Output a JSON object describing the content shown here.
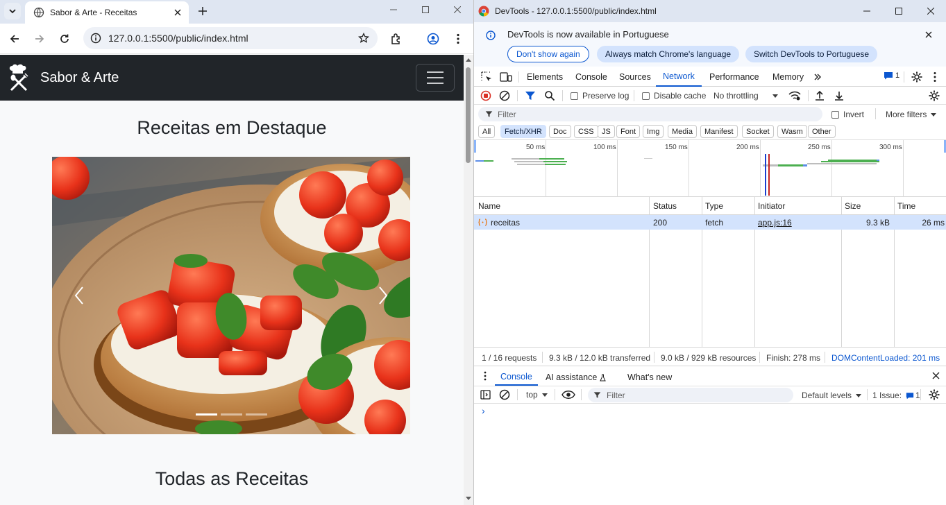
{
  "browser": {
    "tab_title": "Sabor & Arte - Receitas",
    "url": "127.0.0.1:5500/public/index.html"
  },
  "page": {
    "brand": "Sabor & Arte",
    "featured_heading": "Receitas em Destaque",
    "all_heading": "Todas as Receitas",
    "carousel": {
      "slides": 3,
      "active_slide": 1
    }
  },
  "devtools": {
    "title": "DevTools - 127.0.0.1:5500/public/index.html",
    "infobar": {
      "message": "DevTools is now available in Portuguese",
      "dont_show": "Don't show again",
      "always_match": "Always match Chrome's language",
      "switch": "Switch DevTools to Portuguese"
    },
    "panel_tabs": [
      "Elements",
      "Console",
      "Sources",
      "Network",
      "Performance",
      "Memory"
    ],
    "active_panel": "Network",
    "issues_count": "1",
    "toolbar": {
      "preserve_log": "Preserve log",
      "disable_cache": "Disable cache",
      "throttling": "No throttling"
    },
    "filter": {
      "placeholder": "Filter",
      "invert": "Invert",
      "more_filters": "More filters"
    },
    "type_filters": [
      "All",
      "Fetch/XHR",
      "Doc",
      "CSS",
      "JS",
      "Font",
      "Img",
      "Media",
      "Manifest",
      "Socket",
      "Wasm",
      "Other"
    ],
    "active_type": "Fetch/XHR",
    "timeline_ticks": [
      "50 ms",
      "100 ms",
      "150 ms",
      "200 ms",
      "250 ms",
      "300 ms"
    ],
    "columns": [
      "Name",
      "Status",
      "Type",
      "Initiator",
      "Size",
      "Time"
    ],
    "rows": [
      {
        "name": "receitas",
        "status": "200",
        "type": "fetch",
        "initiator": "app.js:16",
        "size": "9.3 kB",
        "time": "26 ms"
      }
    ],
    "summary": {
      "requests": "1 / 16 requests",
      "transferred": "9.3 kB / 12.0 kB transferred",
      "resources": "9.0 kB / 929 kB resources",
      "finish": "Finish: 278 ms",
      "dcl": "DOMContentLoaded: 201 ms"
    },
    "drawer": {
      "tabs": [
        "Console",
        "AI assistance",
        "What's new"
      ],
      "context": "top",
      "filter_placeholder": "Filter",
      "levels": "Default levels",
      "issues_label": "1 Issue:",
      "issues_count": "1",
      "prompt": "›"
    }
  },
  "colors": {
    "navbar": "#212529",
    "accent": "#0b57d0",
    "selected_row": "#d3e3fd"
  }
}
